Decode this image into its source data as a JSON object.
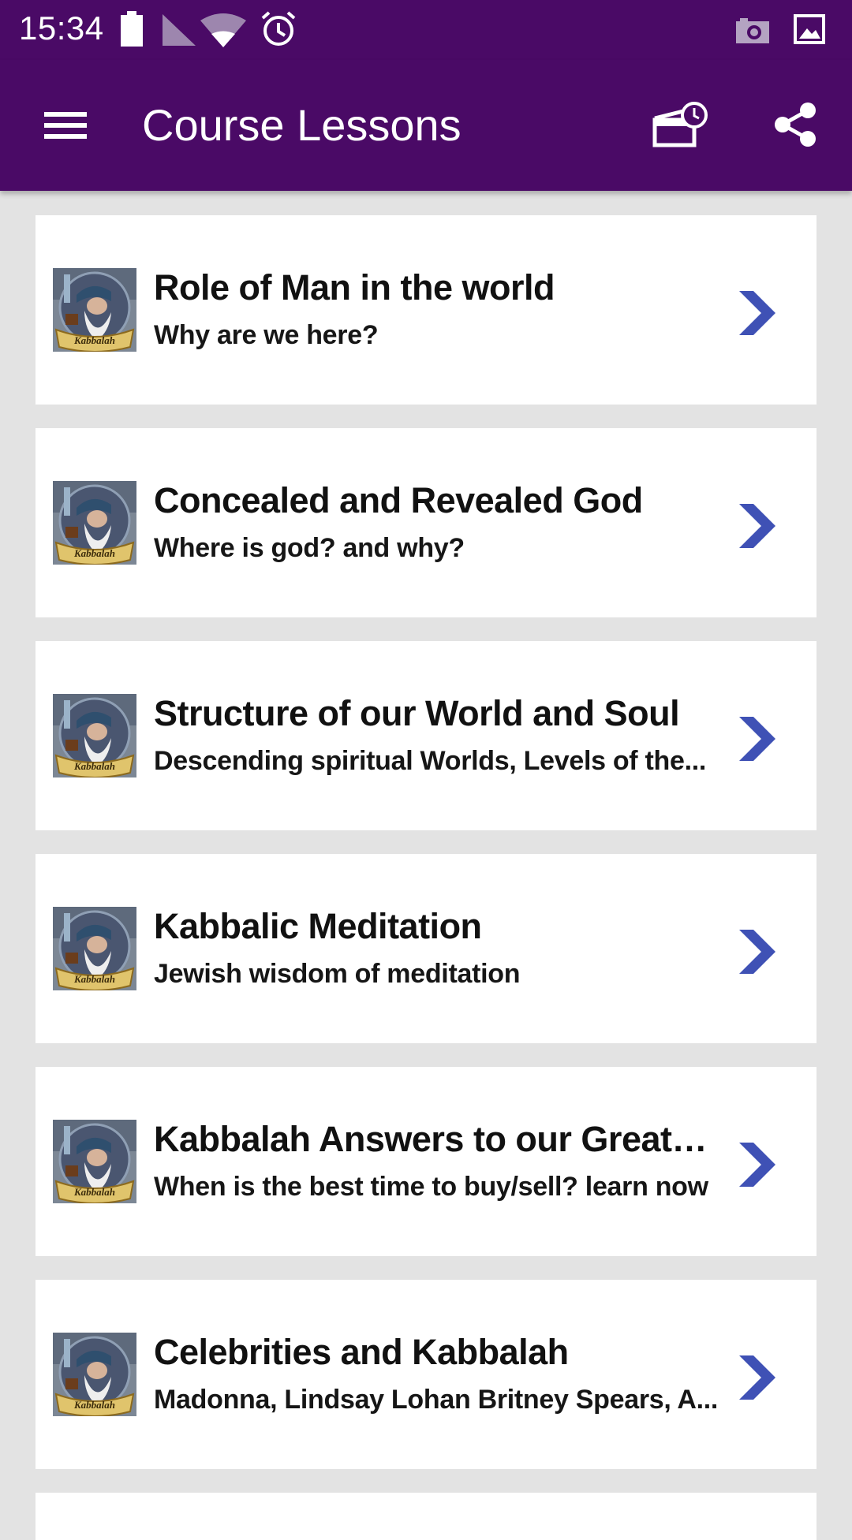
{
  "status_bar": {
    "time": "15:34",
    "icons": [
      "battery-icon",
      "signal-icon",
      "wifi-icon",
      "alarm-icon",
      "camera-notification-icon",
      "image-notification-icon"
    ]
  },
  "app_bar": {
    "title": "Course Lessons",
    "icons": [
      "menu-icon",
      "schedule-icon",
      "share-icon"
    ],
    "color": "#4a0a66"
  },
  "colors": {
    "chevron": "#3f51b5",
    "card_bg": "#ffffff",
    "page_bg": "#e3e3e3"
  },
  "lessons": [
    {
      "title": "Role of Man in the world",
      "subtitle": "Why are we here?",
      "thumb_label": "Kabbalah"
    },
    {
      "title": "Concealed and Revealed God",
      "subtitle": "Where is god? and why?",
      "thumb_label": "Kabbalah"
    },
    {
      "title": "Structure of our World and Soul",
      "subtitle": "Descending spiritual Worlds, Levels of the...",
      "thumb_label": "Kabbalah"
    },
    {
      "title": "Kabbalic Meditation",
      "subtitle": "Jewish wisdom of meditation",
      "thumb_label": "Kabbalah"
    },
    {
      "title": "Kabbalah Answers to our Greatest...",
      "subtitle": "When is the best time to buy/sell? learn now",
      "thumb_label": "Kabbalah"
    },
    {
      "title": "Celebrities and Kabbalah",
      "subtitle": "Madonna, Lindsay Lohan Britney Spears, A...",
      "thumb_label": "Kabbalah"
    }
  ]
}
